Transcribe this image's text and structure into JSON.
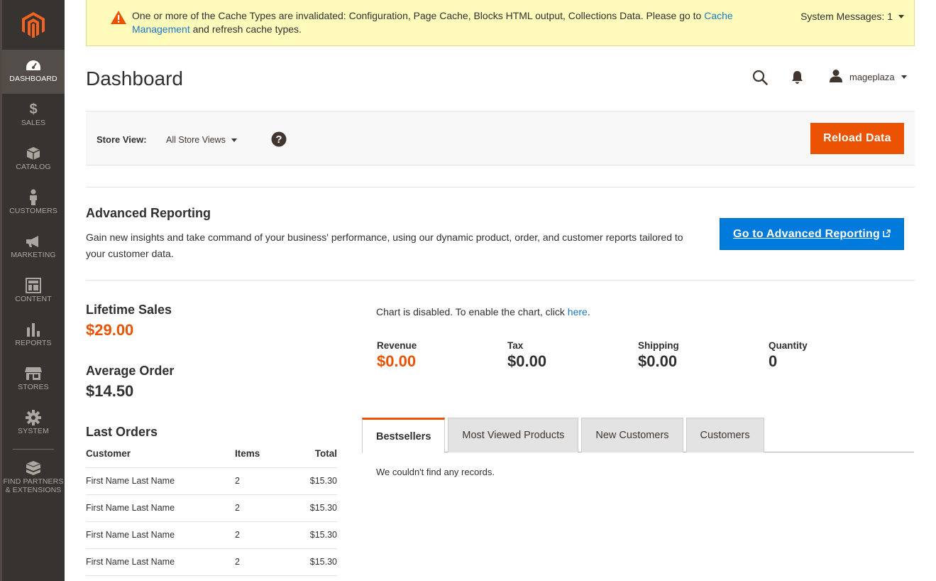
{
  "sidebar": {
    "items": [
      {
        "label": "DASHBOARD",
        "icon": "dashboard-icon",
        "active": true
      },
      {
        "label": "SALES",
        "icon": "dollar-icon"
      },
      {
        "label": "CATALOG",
        "icon": "box-icon"
      },
      {
        "label": "CUSTOMERS",
        "icon": "person-icon"
      },
      {
        "label": "MARKETING",
        "icon": "megaphone-icon"
      },
      {
        "label": "CONTENT",
        "icon": "layout-icon"
      },
      {
        "label": "REPORTS",
        "icon": "bar-chart-icon"
      },
      {
        "label": "STORES",
        "icon": "storefront-icon"
      },
      {
        "label": "SYSTEM",
        "icon": "gear-icon"
      }
    ],
    "partners_label_1": "FIND PARTNERS",
    "partners_label_2": "& EXTENSIONS"
  },
  "system_message": {
    "text_before": "One or more of the Cache Types are invalidated: Configuration, Page Cache, Blocks HTML output, Collections Data. Please go to ",
    "link_text": "Cache Management",
    "text_after": " and refresh cache types.",
    "count_label": "System Messages: 1"
  },
  "header": {
    "title": "Dashboard",
    "username": "mageplaza"
  },
  "store_switcher": {
    "label": "Store View:",
    "value": "All Store Views",
    "reload_label": "Reload Data"
  },
  "advanced_reporting": {
    "title": "Advanced Reporting",
    "description": "Gain new insights and take command of your business' performance, using our dynamic product, order, and customer reports tailored to your customer data.",
    "button_label": "Go to Advanced Reporting"
  },
  "stats": {
    "lifetime_sales_label": "Lifetime Sales",
    "lifetime_sales_value": "$29.00",
    "average_order_label": "Average Order",
    "average_order_value": "$14.50"
  },
  "last_orders": {
    "title": "Last Orders",
    "headers": {
      "customer": "Customer",
      "items": "Items",
      "total": "Total"
    },
    "rows": [
      {
        "customer": "First Name Last Name",
        "items": "2",
        "total": "$15.30"
      },
      {
        "customer": "First Name Last Name",
        "items": "2",
        "total": "$15.30"
      },
      {
        "customer": "First Name Last Name",
        "items": "2",
        "total": "$15.30"
      },
      {
        "customer": "First Name Last Name",
        "items": "2",
        "total": "$15.30"
      }
    ]
  },
  "chart_note": {
    "text": "Chart is disabled. To enable the chart, click ",
    "link": "here",
    "suffix": "."
  },
  "totals": [
    {
      "label": "Revenue",
      "value": "$0.00"
    },
    {
      "label": "Tax",
      "value": "$0.00"
    },
    {
      "label": "Shipping",
      "value": "$0.00"
    },
    {
      "label": "Quantity",
      "value": "0"
    }
  ],
  "tabs": [
    {
      "label": "Bestsellers",
      "active": true
    },
    {
      "label": "Most Viewed Products"
    },
    {
      "label": "New Customers"
    },
    {
      "label": "Customers"
    }
  ],
  "tab_content": {
    "empty_text": "We couldn't find any records."
  },
  "colors": {
    "accent": "#eb5202",
    "link": "#1979c3",
    "primary_button": "#007bdb",
    "sidebar": "#373330",
    "message_bg": "#fffbbb"
  }
}
